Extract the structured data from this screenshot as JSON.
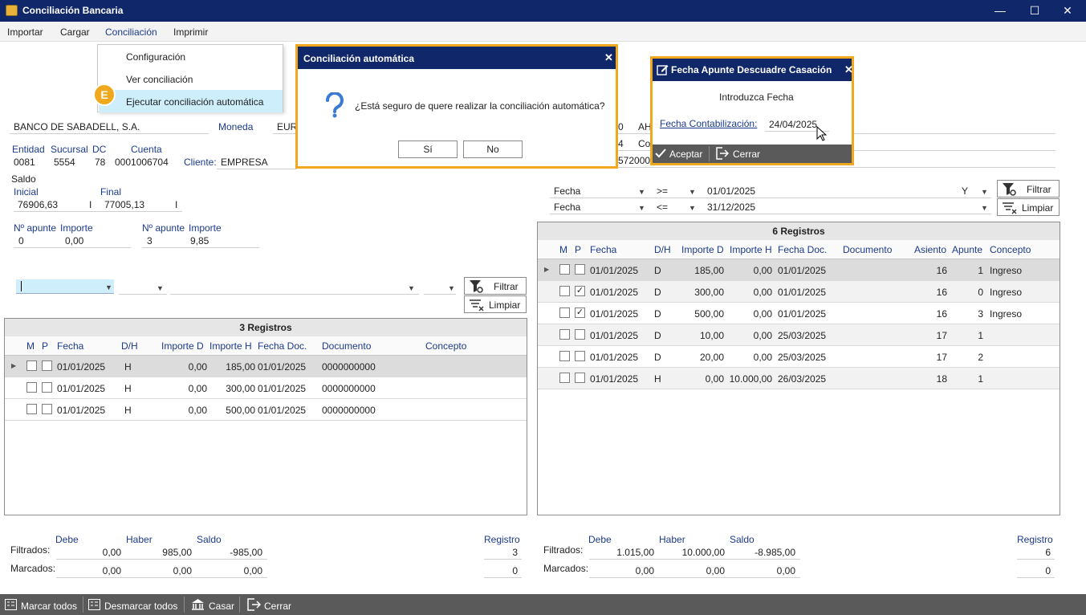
{
  "window": {
    "title": "Conciliación Bancaria",
    "min": "—",
    "max": "☐",
    "close": "✕"
  },
  "menu": {
    "items": [
      "Importar",
      "Cargar",
      "Conciliación",
      "Imprimir"
    ],
    "dropdown": [
      "Configuración",
      "Ver conciliación",
      "Ejecutar conciliación automática"
    ],
    "badge": "E"
  },
  "account": {
    "bank": "BANCO DE SABADELL, S.A.",
    "currency_label": "Moneda",
    "currency": "EUR",
    "entidad_l": "Entidad",
    "sucursal_l": "Sucursal",
    "dc_l": "DC",
    "cuenta_l": "Cuenta",
    "entidad": "0081",
    "sucursal": "5554",
    "dc": "78",
    "cuenta": "0001006704",
    "cliente_l": "Cliente:",
    "cliente": "EMPRESA",
    "saldo_l": "Saldo",
    "inicial_l": "Inicial",
    "final_l": "Final",
    "inicial": "76906,63",
    "final": "77005,13",
    "inicial_suf": "I",
    "final_suf": "I",
    "napunte1_l": "Nº apunte",
    "importe1_l": "Importe",
    "napunte1": "0",
    "importe1": "0,00",
    "napunte2_l": "Nº apunte",
    "importe2_l": "Importe",
    "napunte2": "3",
    "importe2": "9,85",
    "right_a": "0",
    "right_b": "4",
    "right_c": "AH",
    "right_d": "Co",
    "right_e": "572000"
  },
  "left_filter": {
    "filtrar": "Filtrar",
    "limpiar": "Limpiar"
  },
  "right_filter": {
    "field1": "Fecha",
    "op1": ">=",
    "val1": "01/01/2025",
    "conj": "Y",
    "field2": "Fecha",
    "op2": "<=",
    "val2": "31/12/2025",
    "filtrar": "Filtrar",
    "limpiar": "Limpiar"
  },
  "left_grid": {
    "title": "3 Registros",
    "cols": [
      "M",
      "P",
      "Fecha",
      "D/H",
      "Importe D",
      "Importe H",
      "Fecha Doc.",
      "Documento",
      "Concepto"
    ],
    "rows": [
      [
        "01/01/2025",
        "H",
        "0,00",
        "185,00",
        "01/01/2025",
        "0000000000"
      ],
      [
        "01/01/2025",
        "H",
        "0,00",
        "300,00",
        "01/01/2025",
        "0000000000"
      ],
      [
        "01/01/2025",
        "H",
        "0,00",
        "500,00",
        "01/01/2025",
        "0000000000"
      ]
    ]
  },
  "right_grid": {
    "title": "6 Registros",
    "cols": [
      "M",
      "P",
      "Fecha",
      "D/H",
      "Importe D",
      "Importe H",
      "Fecha Doc.",
      "Documento",
      "Asiento",
      "Apunte",
      "Concepto"
    ],
    "rows": [
      {
        "p": false,
        "c": [
          "01/01/2025",
          "D",
          "185,00",
          "0,00",
          "01/01/2025",
          "",
          "16",
          "1",
          "Ingreso"
        ]
      },
      {
        "p": true,
        "c": [
          "01/01/2025",
          "D",
          "300,00",
          "0,00",
          "01/01/2025",
          "",
          "16",
          "0",
          "Ingreso"
        ]
      },
      {
        "p": true,
        "c": [
          "01/01/2025",
          "D",
          "500,00",
          "0,00",
          "01/01/2025",
          "",
          "16",
          "3",
          "Ingreso"
        ]
      },
      {
        "p": false,
        "c": [
          "01/01/2025",
          "D",
          "10,00",
          "0,00",
          "25/03/2025",
          "",
          "17",
          "1",
          ""
        ]
      },
      {
        "p": false,
        "c": [
          "01/01/2025",
          "D",
          "20,00",
          "0,00",
          "25/03/2025",
          "",
          "17",
          "2",
          ""
        ]
      },
      {
        "p": false,
        "c": [
          "01/01/2025",
          "H",
          "0,00",
          "10.000,00",
          "26/03/2025",
          "",
          "18",
          "1",
          ""
        ]
      }
    ]
  },
  "left_totals": {
    "debe_l": "Debe",
    "haber_l": "Haber",
    "saldo_l": "Saldo",
    "registro_l": "Registro",
    "filtrados_l": "Filtrados:",
    "marcados_l": "Marcados:",
    "f_debe": "0,00",
    "f_haber": "985,00",
    "f_saldo": "-985,00",
    "f_reg": "3",
    "m_debe": "0,00",
    "m_haber": "0,00",
    "m_saldo": "0,00",
    "m_reg": "0"
  },
  "right_totals": {
    "debe_l": "Debe",
    "haber_l": "Haber",
    "saldo_l": "Saldo",
    "registro_l": "Registro",
    "filtrados_l": "Filtrados:",
    "marcados_l": "Marcados:",
    "f_debe": "1.015,00",
    "f_haber": "10.000,00",
    "f_saldo": "-8.985,00",
    "f_reg": "6",
    "m_debe": "0,00",
    "m_haber": "0,00",
    "m_saldo": "0,00",
    "m_reg": "0"
  },
  "dialog_confirm": {
    "title": "Conciliación automática",
    "message": "¿Está seguro de quere realizar la conciliación automática?",
    "yes": "Sí",
    "no": "No",
    "close": "✕"
  },
  "dialog_date": {
    "title": "Fecha Apunte Descuadre Casación",
    "prompt": "Introduzca Fecha",
    "field_l": "Fecha Contabilización:",
    "field": "24/04/2025",
    "accept": "Aceptar",
    "close_btn": "Cerrar",
    "close": "✕"
  },
  "footer": {
    "marcar": "Marcar todos",
    "desmarcar": "Desmarcar todos",
    "casar": "Casar",
    "cerrar": "Cerrar"
  }
}
